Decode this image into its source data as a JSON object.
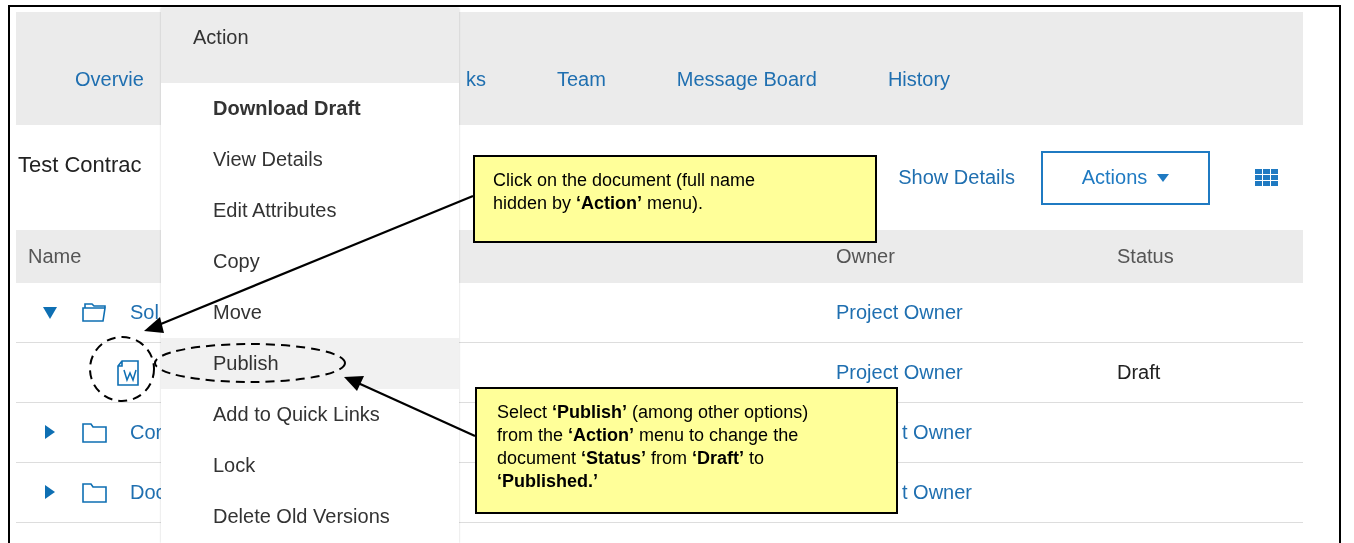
{
  "tabs": [
    {
      "label": "Overvie"
    },
    {
      "label": "ks"
    },
    {
      "label": "Team"
    },
    {
      "label": "Message Board"
    },
    {
      "label": "History"
    }
  ],
  "title": "Test Contrac",
  "toolbar": {
    "show_details": "Show Details",
    "actions": "Actions"
  },
  "table": {
    "columns": [
      "Name",
      "Owner",
      "Status"
    ],
    "rows": [
      {
        "kind": "folder",
        "expanded": true,
        "name": "Sol",
        "owner": "Project Owner"
      },
      {
        "kind": "document",
        "owner": "Project Owner",
        "status": "Draft"
      },
      {
        "kind": "folder",
        "expanded": false,
        "name": "Cor",
        "owner": "t Owner"
      },
      {
        "kind": "folder",
        "expanded": false,
        "name": "Doc",
        "owner": "t Owner"
      }
    ]
  },
  "menu": {
    "title": "Action",
    "items": [
      {
        "label": "Download Draft",
        "bold": true,
        "highlighted": false
      },
      {
        "label": "View Details",
        "bold": false,
        "highlighted": false
      },
      {
        "label": "Edit Attributes",
        "bold": false,
        "highlighted": false
      },
      {
        "label": "Copy",
        "bold": false,
        "highlighted": false
      },
      {
        "label": "Move",
        "bold": false,
        "highlighted": false
      },
      {
        "label": "Publish",
        "bold": false,
        "highlighted": true
      },
      {
        "label": "Add to Quick Links",
        "bold": false,
        "highlighted": false
      },
      {
        "label": "Lock",
        "bold": false,
        "highlighted": false
      },
      {
        "label": "Delete Old Versions",
        "bold": false,
        "highlighted": false
      }
    ]
  },
  "callouts": [
    {
      "text": "Click on the document (full name hidden by **‘Action’** menu)."
    },
    {
      "text": "Select **‘Publish’** (among other options) from the **‘Action’** menu to change the document **‘Status’** from **‘Draft’** to **‘Published.’**"
    }
  ]
}
